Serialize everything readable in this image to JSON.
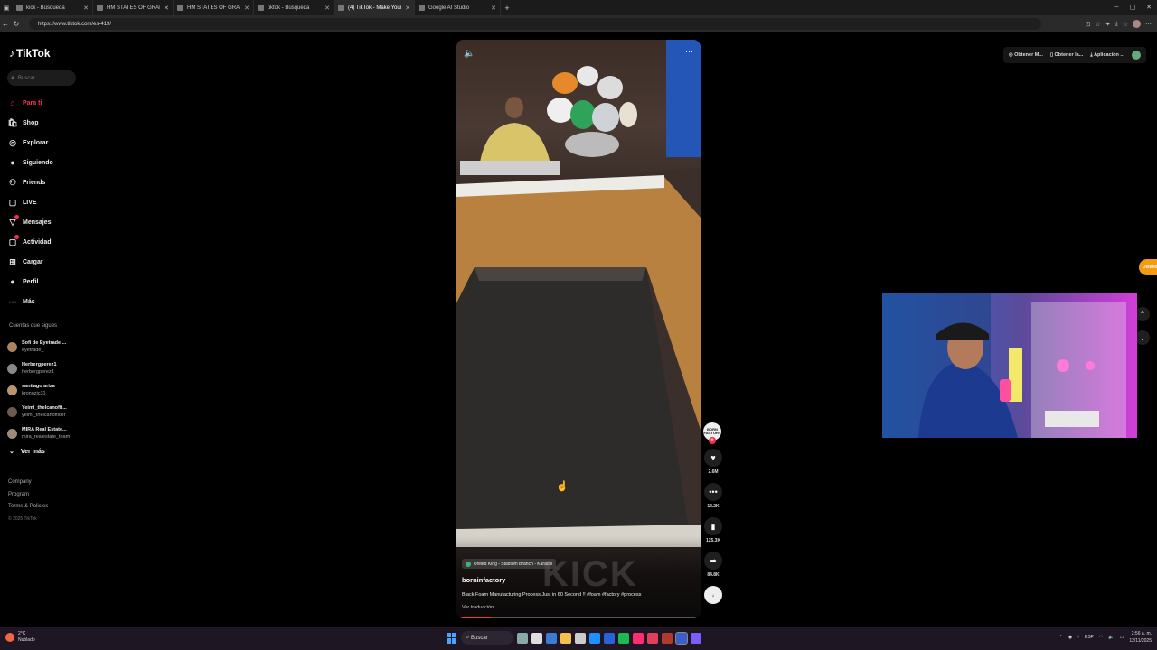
{
  "browser": {
    "tabs": [
      {
        "title": "kick - Búsqueda",
        "active": false
      },
      {
        "title": "HM STATES OF GRAPHICS WORL",
        "active": false
      },
      {
        "title": "HM STATES OF GRAPHICS WORL",
        "active": false
      },
      {
        "title": "tiktok - Búsqueda",
        "active": false
      },
      {
        "title": "(4) TikTok - Make Your Day",
        "active": true
      },
      {
        "title": "Google AI Studio",
        "active": false
      }
    ],
    "new_tab": "+",
    "url": "https://www.tiktok.com/es-419/"
  },
  "sidebar": {
    "logo": "TikTok",
    "search_placeholder": "Buscar",
    "items": [
      {
        "label": "Para ti",
        "icon": "home-icon",
        "glyph": "⌂"
      },
      {
        "label": "Shop",
        "icon": "shop-icon",
        "glyph": "🛍"
      },
      {
        "label": "Explorar",
        "icon": "compass-icon",
        "glyph": "◎"
      },
      {
        "label": "Siguiendo",
        "icon": "following-icon",
        "glyph": "●"
      },
      {
        "label": "Friends",
        "icon": "friends-icon",
        "glyph": "⚇"
      },
      {
        "label": "LIVE",
        "icon": "live-icon",
        "glyph": "▢"
      },
      {
        "label": "Mensajes",
        "icon": "messages-icon",
        "glyph": "▽"
      },
      {
        "label": "Actividad",
        "icon": "activity-icon",
        "glyph": "▢"
      },
      {
        "label": "Cargar",
        "icon": "upload-icon",
        "glyph": "⊞"
      },
      {
        "label": "Perfil",
        "icon": "profile-icon",
        "glyph": "●"
      },
      {
        "label": "Más",
        "icon": "more-icon",
        "glyph": "⋯"
      }
    ],
    "following_title": "Cuentas que sigues",
    "following": [
      {
        "name": "Sofi de Eyetrade ...",
        "handle": "eyetrade_"
      },
      {
        "name": "Herbergperez1",
        "handle": "herbergperez1"
      },
      {
        "name": "santiago ariza",
        "handle": "kronozic31"
      },
      {
        "name": "Yeimi_thelcanoffi...",
        "handle": "yeimi_thelcanofficer"
      },
      {
        "name": "MIRA Real Estate...",
        "handle": "mira_realestate_team"
      }
    ],
    "see_more": "Ver más",
    "footer": [
      "Company",
      "Program",
      "Terms & Policies"
    ],
    "copyright": "© 2025 TikTok"
  },
  "video": {
    "location": "United King - Stadium Branch - Karachi",
    "author": "borninfactory",
    "caption": "Black Foam Manufacturing Process Just in 60 Second !! #foam #factory #process",
    "translate": "Ver traducción",
    "watermark": "KICK",
    "progress": 0.14
  },
  "actions": {
    "avatar_text": "BORN FACTORY",
    "follow": "+",
    "likes": "2.6M",
    "comments": "12.2K",
    "saves": "125.3K",
    "shares": "84.8K"
  },
  "topright": {
    "coins": "Obtener M...",
    "app": "Obtener la...",
    "download": "Aplicación ..."
  },
  "side_pill": "Diseño",
  "taskbar": {
    "temp": "2°C",
    "weather": "Nublado",
    "search": "Buscar",
    "lang": "ESP",
    "time": "2:56 a. m.",
    "date": "12/11/2025"
  },
  "colors": {
    "accent": "#fe2c55",
    "bg": "#000000"
  }
}
